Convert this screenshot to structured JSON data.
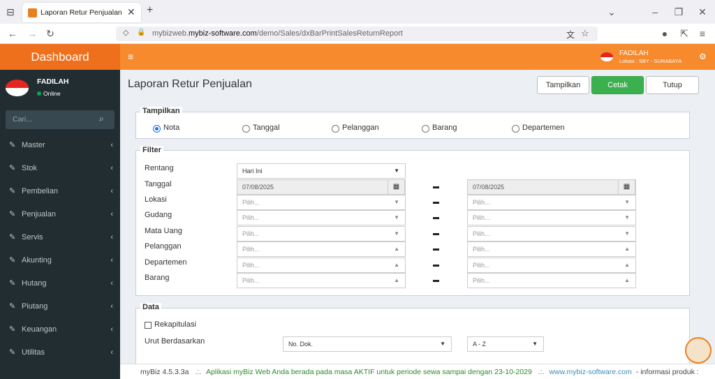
{
  "browser": {
    "tab_title": "Laporan Retur Penjualan",
    "url_host": "mybizweb.mybiz-software.com",
    "url_prefix": "mybizweb.",
    "url_domain": "mybiz-software.com",
    "url_path": "/demo/Sales/dxBarPrintSalesReturnReport",
    "new_tab": "+"
  },
  "header": {
    "brand": "Dashboard",
    "user_name": "FADILAH",
    "user_location": "Lokasi : SBY - SURABAYA"
  },
  "sidebar": {
    "user_name": "FADILAH",
    "status": "Online",
    "search_placeholder": "Cari...",
    "items": [
      {
        "label": "Master"
      },
      {
        "label": "Stok"
      },
      {
        "label": "Pembelian"
      },
      {
        "label": "Penjualan"
      },
      {
        "label": "Servis"
      },
      {
        "label": "Akunting"
      },
      {
        "label": "Hutang"
      },
      {
        "label": "Piutang"
      },
      {
        "label": "Keuangan"
      },
      {
        "label": "Utilitas"
      }
    ]
  },
  "page": {
    "title": "Laporan Retur Penjualan",
    "buttons": {
      "show": "Tampilkan",
      "print": "Cetak",
      "close": "Tutup"
    },
    "tampilkan": {
      "legend": "Tampilkan",
      "options": [
        "Nota",
        "Tanggal",
        "Pelanggan",
        "Barang",
        "Departemen"
      ],
      "selected": "Nota"
    },
    "filter": {
      "legend": "Filter",
      "labels": [
        "Rentang",
        "Tanggal",
        "Lokasi",
        "Gudang",
        "Mata Uang",
        "Pelanggan",
        "Departemen",
        "Barang"
      ],
      "rentang_value": "Hari Ini",
      "date_from": "07/08/2025",
      "date_to": "07/08/2025",
      "placeholder": "Pilih..."
    },
    "data": {
      "legend": "Data",
      "rekap_label": "Rekapitulasi",
      "rekap_checked": false,
      "sort_label": "Urut Berdasarkan",
      "sort_field": "No. Dok.",
      "sort_order": "A - Z"
    }
  },
  "footer": {
    "version": "myBiz 4.5.3.3a",
    "sep": ".:.",
    "notice": "Aplikasi myBiz Web Anda berada pada masa AKTIF untuk periode sewa sampai dengan 23-10-2029",
    "link": "www.mybiz-software.com",
    "info": "- informasi produk :"
  },
  "colors": {
    "accent_orange": "#f68a2c",
    "sidebar_bg": "#222d32",
    "print_green": "#3cb04f",
    "notice_green": "#2c8a2c"
  }
}
